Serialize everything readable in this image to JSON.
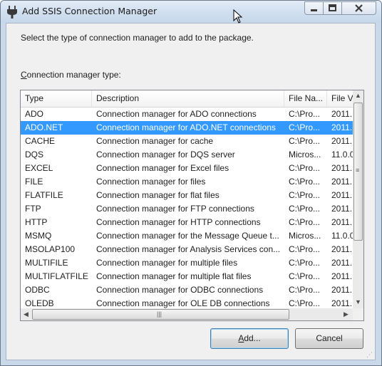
{
  "window": {
    "title": "Add SSIS Connection Manager",
    "icon": "ssis-plug-icon",
    "caption_buttons": [
      "minimize-icon",
      "maximize-icon",
      "close-icon"
    ]
  },
  "dialog": {
    "prompt": "Select the type of connection manager to add to the package.",
    "list_label_mnemonic": "C",
    "list_label_rest": "onnection manager type:"
  },
  "list": {
    "columns": [
      "Type",
      "Description",
      "File Na...",
      "File V"
    ],
    "selected_index": 1,
    "rows": [
      {
        "type": "ADO",
        "description": "Connection manager for ADO connections",
        "file_name": "C:\\Pro...",
        "file_version": "2011."
      },
      {
        "type": "ADO.NET",
        "description": "Connection manager for ADO.NET connections",
        "file_name": "C:\\Pro...",
        "file_version": "2011."
      },
      {
        "type": "CACHE",
        "description": "Connection manager for cache",
        "file_name": "C:\\Pro...",
        "file_version": "2011."
      },
      {
        "type": "DQS",
        "description": "Connection manager for DQS server",
        "file_name": "Micros...",
        "file_version": "11.0.0"
      },
      {
        "type": "EXCEL",
        "description": "Connection manager for Excel files",
        "file_name": "C:\\Pro...",
        "file_version": "2011."
      },
      {
        "type": "FILE",
        "description": "Connection manager for files",
        "file_name": "C:\\Pro...",
        "file_version": "2011."
      },
      {
        "type": "FLATFILE",
        "description": "Connection manager for flat files",
        "file_name": "C:\\Pro...",
        "file_version": "2011."
      },
      {
        "type": "FTP",
        "description": "Connection manager for FTP connections",
        "file_name": "C:\\Pro...",
        "file_version": "2011."
      },
      {
        "type": "HTTP",
        "description": "Connection manager for HTTP connections",
        "file_name": "C:\\Pro...",
        "file_version": "2011."
      },
      {
        "type": "MSMQ",
        "description": "Connection manager for the Message Queue t...",
        "file_name": "Micros...",
        "file_version": "11.0.0"
      },
      {
        "type": "MSOLAP100",
        "description": "Connection manager for Analysis Services con...",
        "file_name": "C:\\Pro...",
        "file_version": "2011."
      },
      {
        "type": "MULTIFILE",
        "description": "Connection manager for multiple files",
        "file_name": "C:\\Pro...",
        "file_version": "2011."
      },
      {
        "type": "MULTIFLATFILE",
        "description": "Connection manager for multiple flat files",
        "file_name": "C:\\Pro...",
        "file_version": "2011."
      },
      {
        "type": "ODBC",
        "description": "Connection manager for ODBC connections",
        "file_name": "C:\\Pro...",
        "file_version": "2011."
      },
      {
        "type": "OLEDB",
        "description": "Connection manager for OLE DB connections",
        "file_name": "C:\\Pro...",
        "file_version": "2011."
      }
    ]
  },
  "buttons": {
    "add_mnemonic": "A",
    "add_rest": "dd...",
    "cancel": "Cancel"
  },
  "colors": {
    "selection": "#3399ff",
    "selection_text": "#ffffff",
    "title_bar": "#d2e0f0",
    "dialog_background": "#f0f0f0"
  }
}
